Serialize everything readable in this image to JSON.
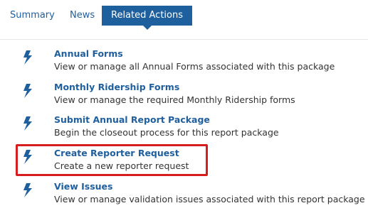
{
  "tabs": [
    {
      "label": "Summary",
      "active": false
    },
    {
      "label": "News",
      "active": false
    },
    {
      "label": "Related Actions",
      "active": true
    }
  ],
  "colors": {
    "accent": "#1e5f9e",
    "link": "#1f5f9e",
    "highlight_border": "#d71d1d"
  },
  "actions": [
    {
      "icon": "lightning-bolt-icon",
      "title": "Annual Forms",
      "description": "View or manage all Annual Forms associated with this package"
    },
    {
      "icon": "lightning-bolt-icon",
      "title": "Monthly Ridership Forms",
      "description": "View or manage the required Monthly Ridership forms"
    },
    {
      "icon": "lightning-bolt-icon",
      "title": "Submit Annual Report Package",
      "description": "Begin the closeout process for this report package"
    },
    {
      "icon": "lightning-bolt-icon",
      "title": "Create Reporter Request",
      "description": "Create a new reporter request",
      "highlighted": true
    },
    {
      "icon": "lightning-bolt-icon",
      "title": "View Issues",
      "description": "View or manage validation issues associated with this report package"
    }
  ]
}
